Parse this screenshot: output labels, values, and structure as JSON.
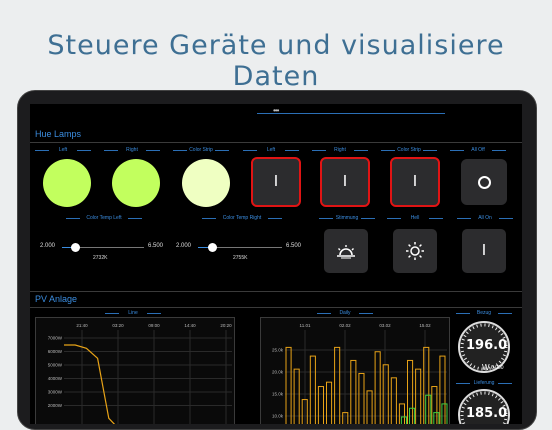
{
  "headline": "Steuere Geräte und visualisiere Daten",
  "topbar": {
    "dots": "•••"
  },
  "hue": {
    "title": "Hue Lamps",
    "lamps": [
      {
        "label": "Left",
        "color": "#c2ff5e"
      },
      {
        "label": "Right",
        "color": "#c2ff5e"
      },
      {
        "label": "Color Strip",
        "color": "#efffc2"
      }
    ],
    "switches": [
      {
        "label": "Left",
        "symbol": "I"
      },
      {
        "label": "Right",
        "symbol": "I"
      },
      {
        "label": "Color Strip",
        "symbol": "I"
      }
    ],
    "all_off": {
      "label": "All Off"
    },
    "color_temp_left": {
      "label": "Color Temp Left",
      "min": "2.000",
      "max": "6.500",
      "value": "2732K",
      "fraction": 0.16
    },
    "color_temp_right": {
      "label": "Color Temp Right",
      "min": "2.000",
      "max": "6.500",
      "value": "2755K",
      "fraction": 0.17
    },
    "scenes": [
      {
        "label": "Stimmung",
        "icon": "sunrise-icon"
      },
      {
        "label": "Hell",
        "icon": "sun-icon"
      },
      {
        "label": "All On",
        "icon": "power-on-icon",
        "symbol": "I"
      }
    ]
  },
  "pv": {
    "title": "PV Anlage",
    "line_label": "Line",
    "daily_label": "Daily",
    "bezug": {
      "label": "Bezug",
      "value": "196.0",
      "unit": "W",
      "max": "6.000"
    },
    "lieferung": {
      "label": "Lieferung",
      "value": "185.0"
    }
  },
  "chart_data": [
    {
      "type": "line",
      "title": "Line",
      "x": [
        "21:40",
        "03:20",
        "09:00",
        "14:40",
        "20:20"
      ],
      "ytick_labels": [
        "7000W",
        "6000W",
        "5000W",
        "4000W",
        "3000W",
        "2000W"
      ],
      "series": [
        {
          "values": [
            6600,
            6600,
            6400,
            5800,
            2200,
            1500,
            1500,
            1500,
            1500,
            1500,
            1500,
            1500,
            1500,
            1500,
            1500,
            1500
          ]
        }
      ],
      "ylim": [
        1500,
        7500
      ],
      "grid": true
    },
    {
      "type": "bar",
      "title": "Daily",
      "x": [
        "11.01",
        "02.02",
        "03.02",
        "15.02"
      ],
      "ytick_labels": [
        "25.0k",
        "20.0k",
        "15.0k",
        "10.0k"
      ],
      "series": [
        {
          "color": "#e8a317",
          "values": [
            24,
            19,
            12,
            22,
            15,
            16,
            24,
            9,
            21,
            18,
            14,
            23,
            20,
            17,
            11,
            21,
            19,
            24,
            15,
            22
          ]
        },
        {
          "color": "#3fcf3f",
          "values": [
            0,
            0,
            0,
            0,
            0,
            0,
            0,
            0,
            0,
            0,
            0,
            0,
            0,
            0,
            8,
            10,
            6,
            13,
            9,
            11
          ]
        }
      ],
      "ylim": [
        5,
        28
      ],
      "grid": true
    }
  ]
}
